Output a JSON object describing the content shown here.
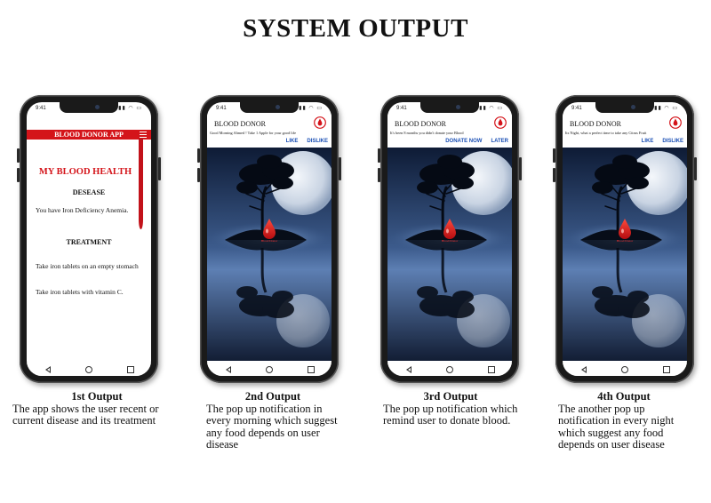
{
  "title": "SYSTEM OUTPUT",
  "status_time": "9:41",
  "phone1": {
    "app_name": "BLOOD DONOR APP",
    "heading": "MY BLOOD HEALTH",
    "disease_label": "DESEASE",
    "disease_text": "You have Iron Deficiency Anemia.",
    "treatment_label": "TREATMENT",
    "treatments": [
      "Take iron tablets on an empty stomach",
      "Take iron tablets with vitamin C."
    ]
  },
  "phone2": {
    "notif_title": "BLOOD DONOR",
    "notif_message": "Good Morning Ahmed ! Take 1 Apple for your good life",
    "action1": "LIKE",
    "action2": "DISLIKE",
    "drop_label": "Blood Donor"
  },
  "phone3": {
    "notif_title": "BLOOD DONOR",
    "notif_message": "It's been 8 months you didn't donate your Blood",
    "action1": "DONATE NOW",
    "action2": "LATER",
    "drop_label": "Blood Donor"
  },
  "phone4": {
    "notif_title": "BLOOD DONOR",
    "notif_message": "Its Night, what a perfect time to take any Citrus Fruit",
    "action1": "LIKE",
    "action2": "DISLIKE",
    "drop_label": "Blood Donor"
  },
  "captions": [
    {
      "heading": "1st Output",
      "text": "The app shows the user recent or current disease and its treatment"
    },
    {
      "heading": "2nd Output",
      "text": "The pop up notification in every morning which suggest any food depends on user disease"
    },
    {
      "heading": "3rd Output",
      "text": "The pop up notification which remind user to donate blood."
    },
    {
      "heading": "4th Output",
      "text": "The another pop up notification in every night which suggest any food depends on user disease"
    }
  ],
  "colors": {
    "accent_red": "#d4141a",
    "action_blue": "#1a4fb5",
    "scene_dark": "#0d1a33"
  }
}
